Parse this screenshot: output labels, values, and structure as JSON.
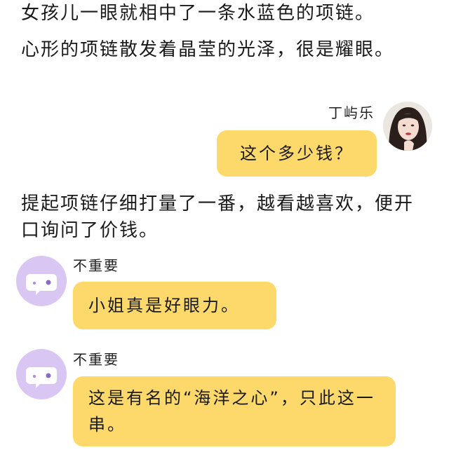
{
  "narration": {
    "line1": "女孩儿一眼就相中了一条水蓝色的项链。",
    "line2": "心形的项链散发着晶莹的光泽，很是耀眼。",
    "line3": "提起项链仔细打量了一番，越看越喜欢，便开口询问了价钱。"
  },
  "messages": [
    {
      "sender": "丁屿乐",
      "text": "这个多少钱？",
      "side": "right",
      "avatar": "portrait-avatar"
    },
    {
      "sender": "不重要",
      "text": "小姐真是好眼力。",
      "side": "left",
      "avatar": "chat-bubble-icon"
    },
    {
      "sender": "不重要",
      "text": "这是有名的“海洋之心”，只此这一串。",
      "side": "left",
      "avatar": "chat-bubble-icon"
    }
  ],
  "colors": {
    "bubble": "#fcd96a",
    "bot_avatar_bg": "#d9c6f2",
    "background": "#ffffff"
  }
}
